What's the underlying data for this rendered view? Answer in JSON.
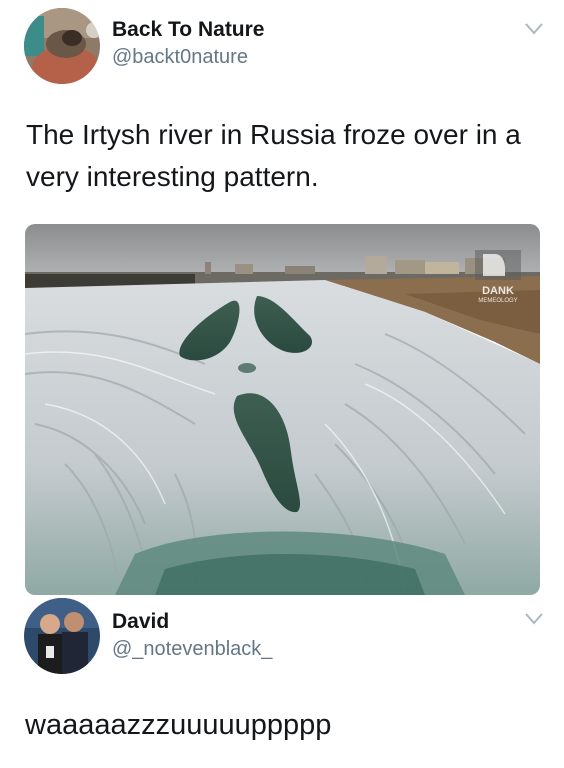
{
  "tweet": {
    "author_name": "Back To Nature",
    "author_handle": "@backt0nature",
    "text": "The Irtysh river in Russia froze over in a very interesting pattern.",
    "media": {
      "watermark_lines": [
        "DANK",
        "MEMEOLOGY"
      ]
    }
  },
  "reply": {
    "author_name": "David",
    "author_handle": "@_notevenblack_",
    "text": "waaaaazzzuuuuuppppp"
  },
  "colors": {
    "text": "#14171a",
    "secondary_text": "#657786",
    "chevron": "#aab8c2"
  },
  "icons": [
    "chevron-down-icon"
  ]
}
